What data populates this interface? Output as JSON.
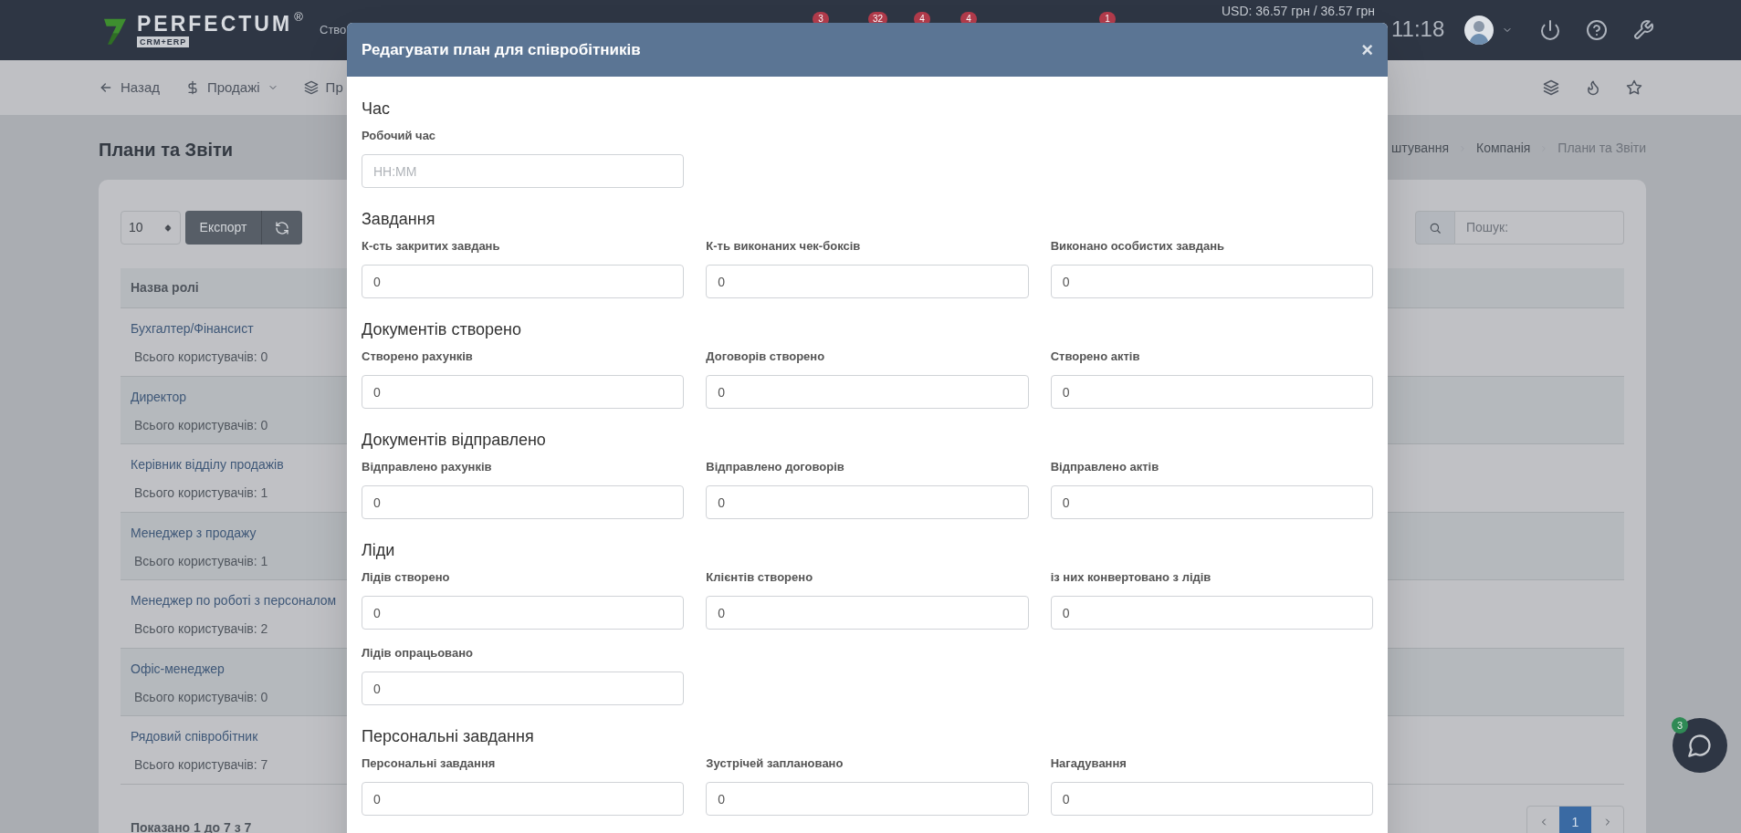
{
  "header": {
    "logo_text": "PERFECTUM",
    "logo_mark": "®",
    "logo_sub": "CRM+ERP",
    "menu_fragment": "Ство",
    "badges": [
      "3",
      "32",
      "4",
      "4",
      "1"
    ],
    "currency": "USD: 36.57 грн / 36.57 грн",
    "clock": "11:18"
  },
  "subnav": {
    "items": [
      {
        "label": "Назад",
        "kind": "back"
      },
      {
        "label": "Продажі",
        "kind": "dropdown"
      },
      {
        "label": "Пр",
        "kind": "layers"
      }
    ]
  },
  "page": {
    "title": "Плани та Звіти",
    "breadcrumbs": [
      "штування",
      "Компанія",
      "Плани та Звіти"
    ],
    "page_size": "10",
    "export_button": "Експорт",
    "search_placeholder": "Пошук:",
    "table": {
      "columns": [
        "Назва ролі"
      ],
      "rows": [
        {
          "role": "Бухгалтер/Фінансист",
          "users": "Всього користувачів: 0"
        },
        {
          "role": "Директор",
          "users": "Всього користувачів: 0"
        },
        {
          "role": "Керівник відділу продажів",
          "users": "Всього користувачів: 1"
        },
        {
          "role": "Менеджер з продажу",
          "users": "Всього користувачів: 1"
        },
        {
          "role": "Менеджер по роботі з персоналом",
          "users": "Всього користувачів: 2"
        },
        {
          "role": "Офіс-менеджер",
          "users": "Всього користувачів: 0"
        },
        {
          "role": "Рядовий співробітник",
          "users": "Всього користувачів: 7"
        }
      ]
    },
    "summary": "Показано 1 до 7 з 7",
    "pagination": [
      {
        "label": "1",
        "selected": true
      }
    ]
  },
  "chat": {
    "badge": "3"
  },
  "modal": {
    "title": "Редагувати план для співробітників",
    "close": "×",
    "sections": [
      {
        "title": "Час",
        "fields": [
          {
            "label": "Робочий час",
            "placeholder": "HH:MM"
          }
        ]
      },
      {
        "title": "Завдання",
        "fields": [
          {
            "label": "К-сть закритих завдань",
            "value": "0"
          },
          {
            "label": "К-ть виконаних чек-боксів",
            "value": "0"
          },
          {
            "label": "Виконано особистих завдань",
            "value": "0"
          }
        ]
      },
      {
        "title": "Документів створено",
        "fields": [
          {
            "label": "Створено рахунків",
            "value": "0"
          },
          {
            "label": "Договорів створено",
            "value": "0"
          },
          {
            "label": "Створено актів",
            "value": "0"
          }
        ]
      },
      {
        "title": "Документів відправлено",
        "fields": [
          {
            "label": "Відправлено рахунків",
            "value": "0"
          },
          {
            "label": "Відправлено договорів",
            "value": "0"
          },
          {
            "label": "Відправлено актів",
            "value": "0"
          }
        ]
      },
      {
        "title": "Ліди",
        "fields": [
          {
            "label": "Лідів створено",
            "value": "0"
          },
          {
            "label": "Клієнтів створено",
            "value": "0"
          },
          {
            "label": "із них конвертовано з лідів",
            "value": "0"
          },
          {
            "label": "Лідів опрацьовано",
            "value": "0"
          }
        ]
      },
      {
        "title": "Персональні завдання",
        "fields": [
          {
            "label": "Персональні завдання",
            "value": "0"
          },
          {
            "label": "Зустрічей заплановано",
            "value": "0"
          },
          {
            "label": "Нагадування",
            "value": "0"
          }
        ]
      }
    ]
  }
}
